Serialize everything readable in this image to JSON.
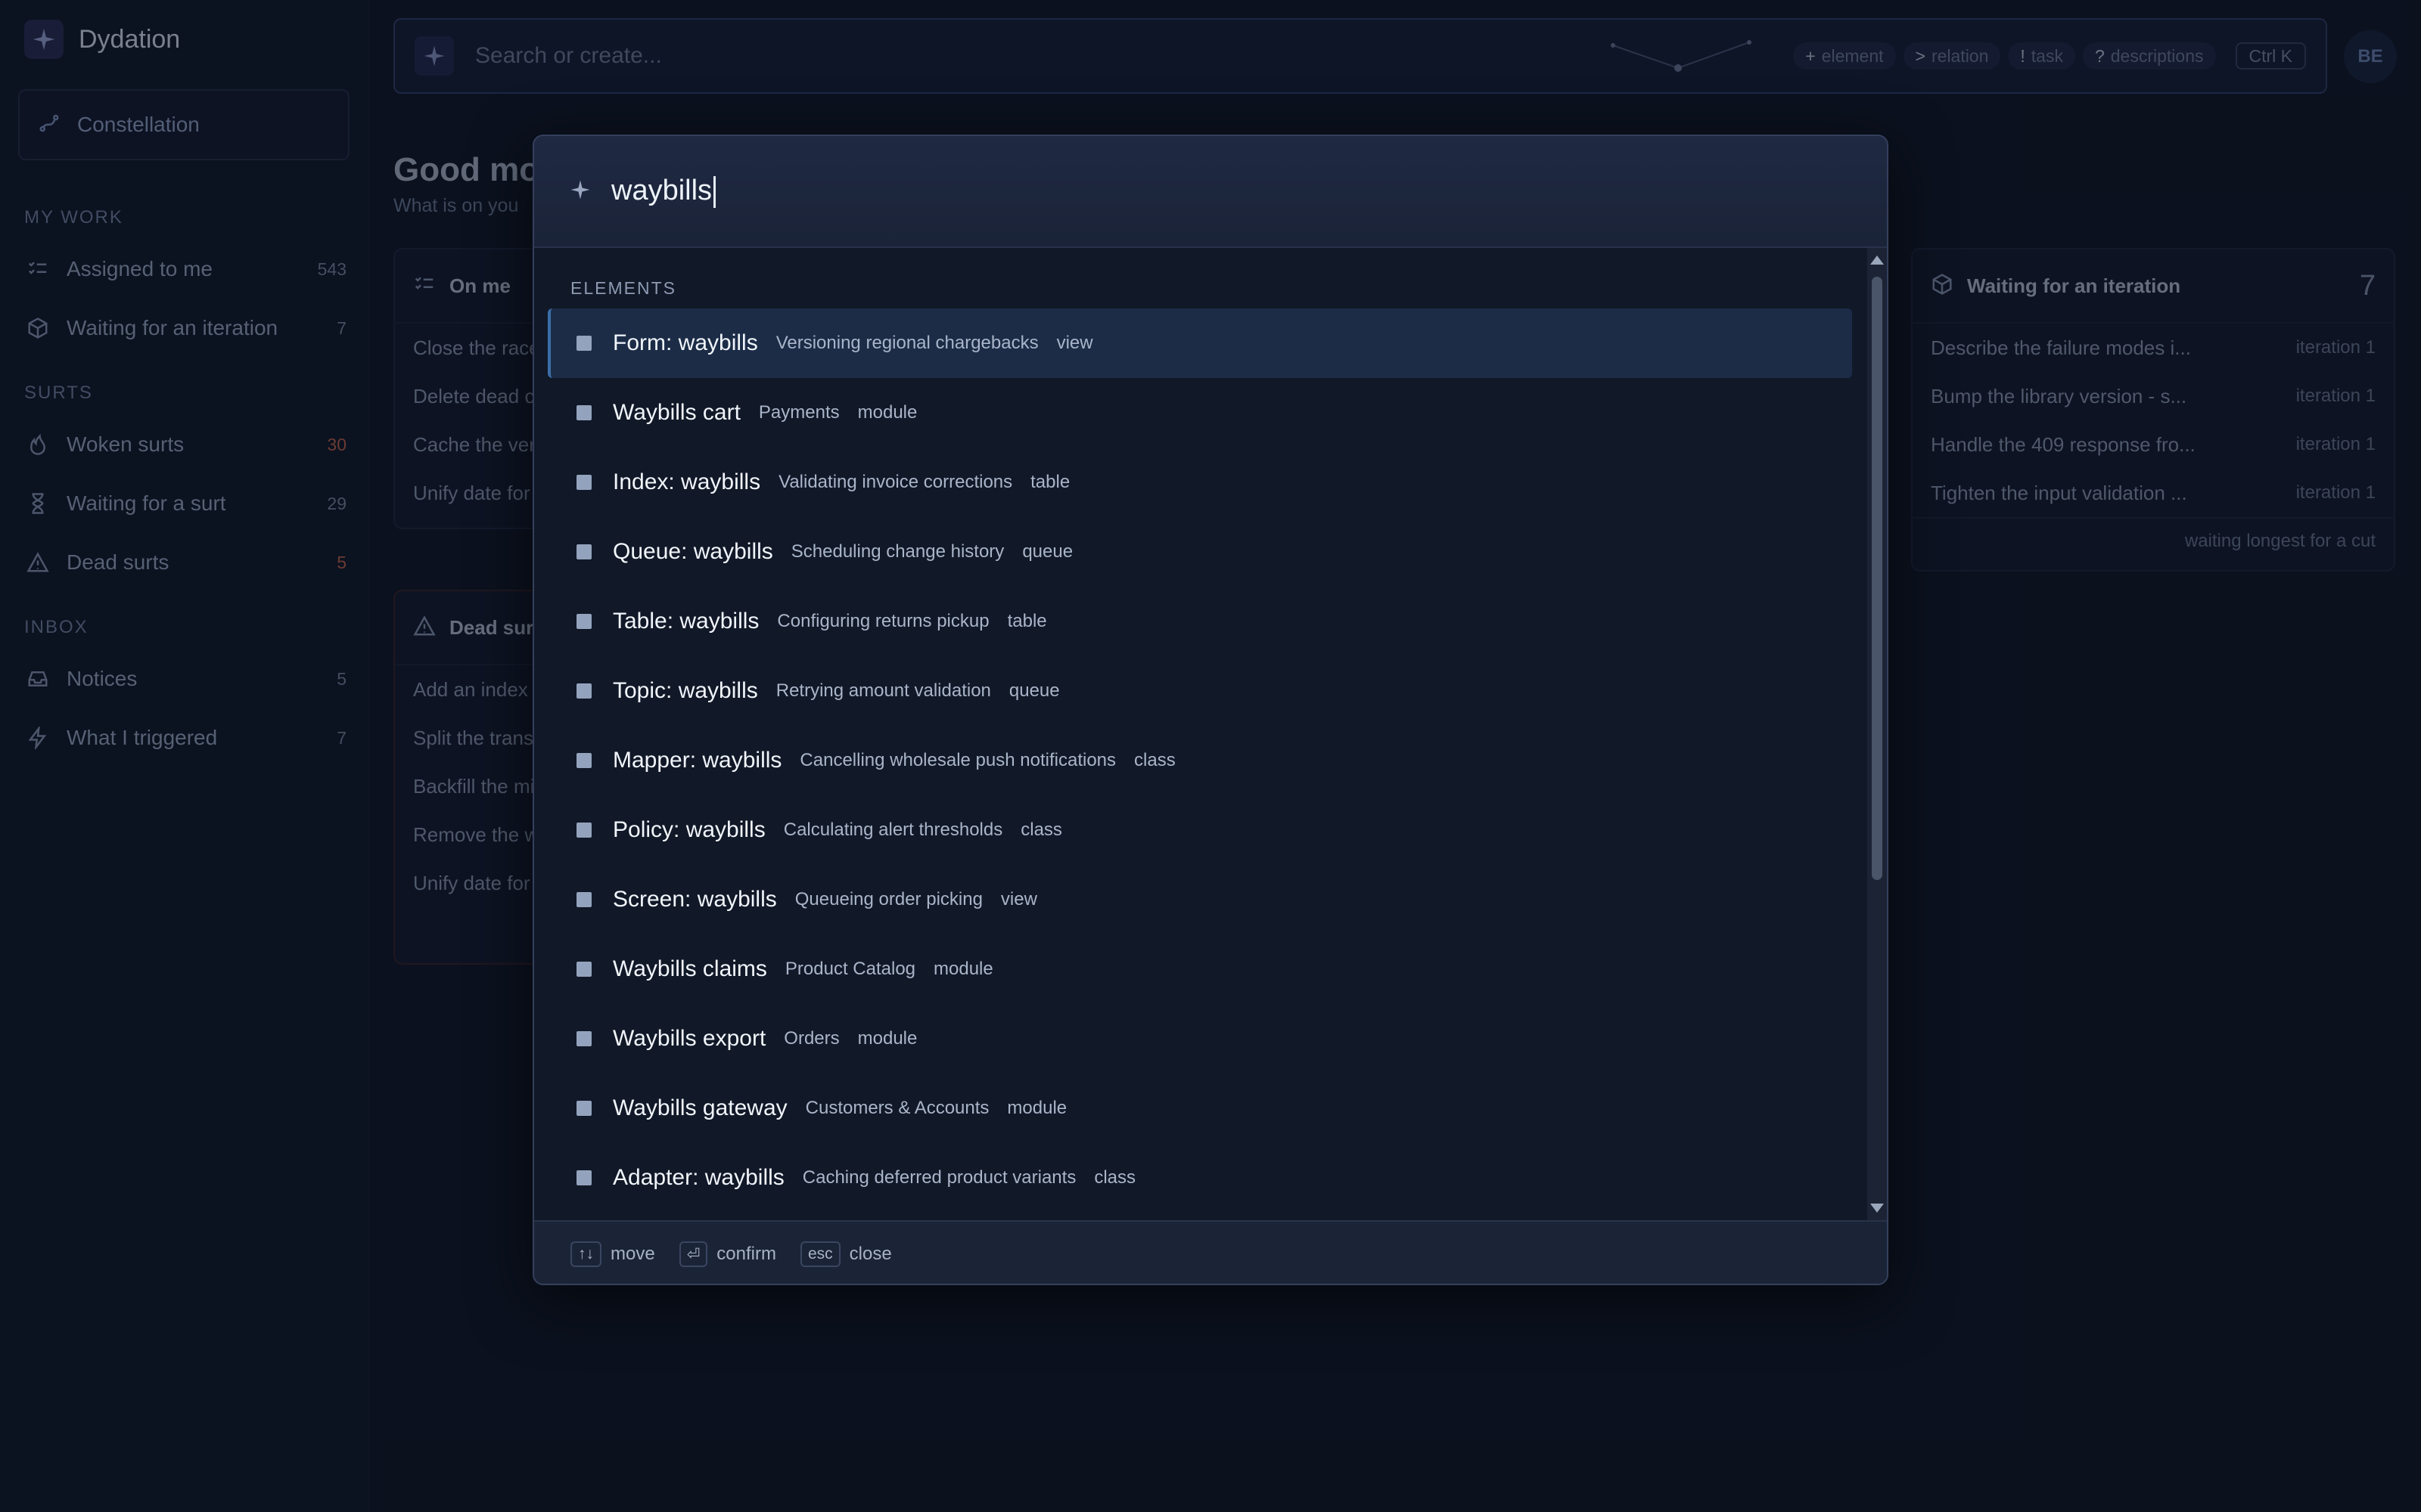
{
  "app": {
    "name": "Dydation"
  },
  "sidebar": {
    "constellation_label": "Constellation",
    "sections": {
      "my_work": "MY WORK",
      "surts": "SURTS",
      "inbox": "INBOX"
    },
    "items": [
      {
        "label": "Assigned to me",
        "count": "543",
        "icon": "checklist-icon"
      },
      {
        "label": "Waiting for an iteration",
        "count": "7",
        "icon": "cube-icon"
      },
      {
        "label": "Woken surts",
        "count": "30",
        "icon": "flame-icon"
      },
      {
        "label": "Waiting for a surt",
        "count": "29",
        "icon": "hourglass-icon"
      },
      {
        "label": "Dead surts",
        "count": "5",
        "icon": "warning-icon"
      },
      {
        "label": "Notices",
        "count": "5",
        "icon": "inbox-icon"
      },
      {
        "label": "What I triggered",
        "count": "7",
        "icon": "bolt-icon"
      }
    ]
  },
  "search": {
    "placeholder": "Search or create...",
    "chips": [
      {
        "sym": "+",
        "label": "element"
      },
      {
        "sym": ">",
        "label": "relation"
      },
      {
        "sym": "!",
        "label": "task"
      },
      {
        "sym": "?",
        "label": "descriptions"
      }
    ],
    "shortcut": "Ctrl K"
  },
  "user": {
    "initials": "BE"
  },
  "main": {
    "greeting": "Good mo",
    "subtitle": "What is on you",
    "on_me": {
      "title": "On me",
      "rows": [
        "Close the race",
        "Delete dead c",
        "Cache the ver",
        "Unify date for"
      ]
    },
    "dead": {
      "title": "Dead surt",
      "rows": [
        "Add an index",
        "Split the trans",
        "Backfill the mi",
        "Remove the w",
        "Unify date for"
      ]
    },
    "waiting": {
      "title": "Waiting for an iteration",
      "count": "7",
      "rows": [
        {
          "text": "Describe the failure modes i...",
          "tag": "iteration 1"
        },
        {
          "text": "Bump the library version - s...",
          "tag": "iteration 1"
        },
        {
          "text": "Handle the 409 response fro...",
          "tag": "iteration 1"
        },
        {
          "text": "Tighten the input validation ...",
          "tag": "iteration 1"
        }
      ],
      "footer": "waiting longest for a cut"
    }
  },
  "palette": {
    "query": "waybills",
    "section_title": "ELEMENTS",
    "results": [
      {
        "name": "Form: waybills",
        "desc": "Versioning regional chargebacks",
        "kind": "view"
      },
      {
        "name": "Waybills cart",
        "desc": "Payments",
        "kind": "module"
      },
      {
        "name": "Index: waybills",
        "desc": "Validating invoice corrections",
        "kind": "table"
      },
      {
        "name": "Queue: waybills",
        "desc": "Scheduling change history",
        "kind": "queue"
      },
      {
        "name": "Table: waybills",
        "desc": "Configuring returns pickup",
        "kind": "table"
      },
      {
        "name": "Topic: waybills",
        "desc": "Retrying amount validation",
        "kind": "queue"
      },
      {
        "name": "Mapper: waybills",
        "desc": "Cancelling wholesale push notifications",
        "kind": "class"
      },
      {
        "name": "Policy: waybills",
        "desc": "Calculating alert thresholds",
        "kind": "class"
      },
      {
        "name": "Screen: waybills",
        "desc": "Queueing order picking",
        "kind": "view"
      },
      {
        "name": "Waybills claims",
        "desc": "Product Catalog",
        "kind": "module"
      },
      {
        "name": "Waybills export",
        "desc": "Orders",
        "kind": "module"
      },
      {
        "name": "Waybills gateway",
        "desc": "Customers & Accounts",
        "kind": "module"
      },
      {
        "name": "Adapter: waybills",
        "desc": "Caching deferred product variants",
        "kind": "class"
      }
    ],
    "hints": [
      {
        "key": "↑↓",
        "label": "move"
      },
      {
        "key": "⏎",
        "label": "confirm"
      },
      {
        "key": "esc",
        "label": "close"
      }
    ]
  },
  "colors": {
    "background": "#111827",
    "selected_row": "#1c2c47",
    "accent": "#3b6ea8",
    "alert_count": "#c2644b"
  }
}
